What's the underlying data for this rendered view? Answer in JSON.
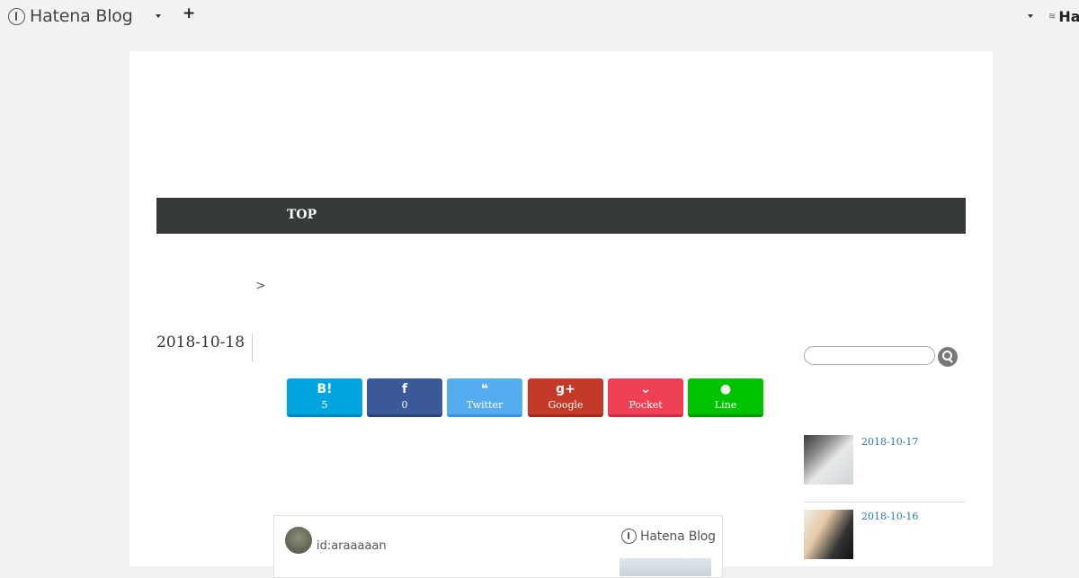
{
  "topbar": {
    "logo_text": "Hatena Blog",
    "right_logo_text": "Ha"
  },
  "nav": {
    "top_label": "TOP"
  },
  "breadcrumb": {
    "separator": ">"
  },
  "article": {
    "date": "2018-10-18"
  },
  "share_buttons": [
    {
      "icon": "B!",
      "label": "5"
    },
    {
      "icon": "f",
      "label": "0"
    },
    {
      "icon": "❝",
      "label": "Twitter"
    },
    {
      "icon": "g+",
      "label": "Google"
    },
    {
      "icon": "⌄",
      "label": "Pocket"
    },
    {
      "icon": "●",
      "label": "Line"
    }
  ],
  "author_card": {
    "id": "id:araaaaan",
    "logo_text": "Hatena Blog"
  },
  "sidebar": {
    "recent": [
      {
        "date": "2018-10-17"
      },
      {
        "date": "2018-10-16"
      }
    ]
  },
  "colors": {
    "page_bg": "#f2f2f2",
    "nav_bg": "#363a3b",
    "link": "#2a79b3",
    "hatena_bookmark": "#00a4de",
    "facebook": "#3b5998",
    "twitter": "#55acee",
    "google": "#c53929",
    "pocket": "#ef4056",
    "line": "#00c300"
  }
}
